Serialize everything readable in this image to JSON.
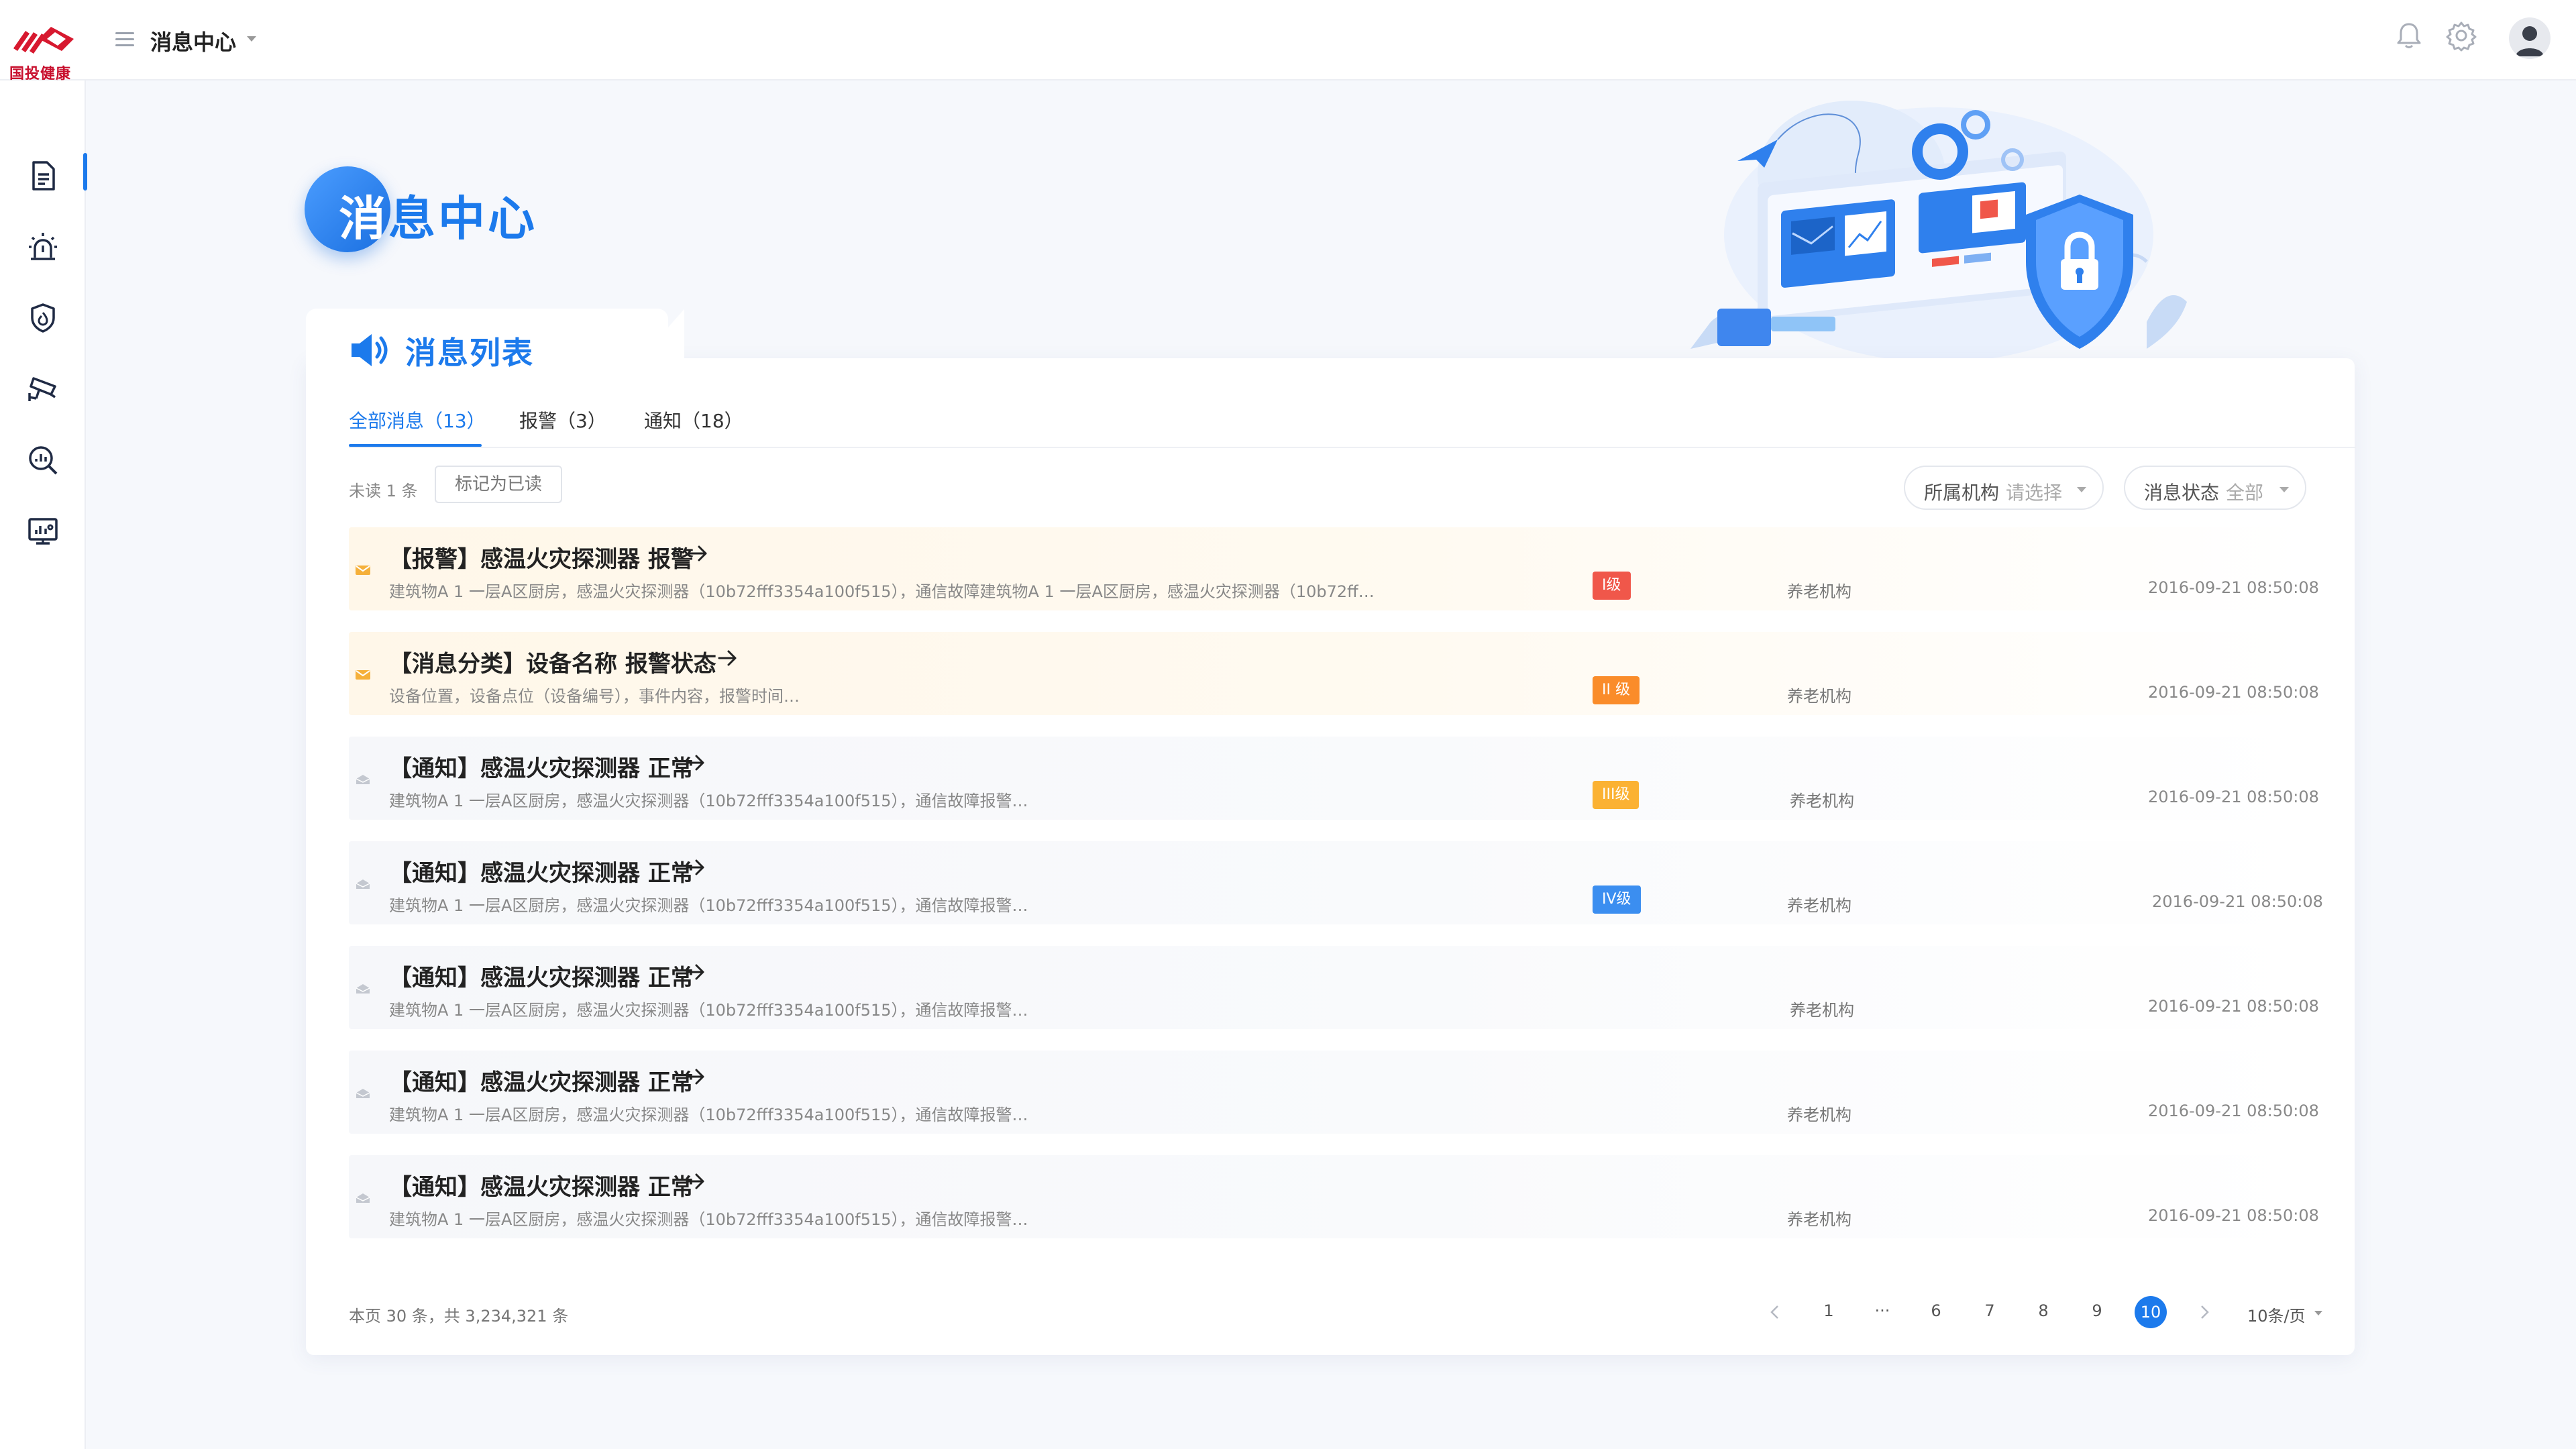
{
  "brand": {
    "logo_text": "国投健康"
  },
  "header": {
    "breadcrumb": "消息中心"
  },
  "page": {
    "title_first": "消",
    "title_rest": "息中心",
    "list_heading": "消息列表"
  },
  "tabs": [
    {
      "label": "全部消息（13）"
    },
    {
      "label": "报警（3）"
    },
    {
      "label": "通知（18）"
    }
  ],
  "toolbar": {
    "unread_text": "未读 1 条",
    "mark_read_label": "标记为已读"
  },
  "filters": {
    "org": {
      "label": "所属机构",
      "placeholder": "请选择"
    },
    "status": {
      "label": "消息状态",
      "value": "全部"
    }
  },
  "messages": [
    {
      "title": "【报警】感温火灾探测器 报警",
      "desc": "建筑物A 1 一层A区厨房，感温火灾探测器（10b72fff3354a100f515），通信故障建筑物A 1 一层A区厨房，感温火灾探测器（10b72ff…",
      "level": "I级",
      "level_color": "#f0574a",
      "org": "养老机构",
      "time": "2016-09-21  08:50:08",
      "unread": true
    },
    {
      "title": "【消息分类】设备名称 报警状态",
      "desc": "设备位置，设备点位（设备编号），事件内容，报警时间…",
      "level": "II 级",
      "level_color": "#fa8c2a",
      "org": "养老机构",
      "time": "2016-09-21  08:50:08",
      "unread": true
    },
    {
      "title": "【通知】感温火灾探测器 正常",
      "desc": "建筑物A 1 一层A区厨房，感温火灾探测器（10b72fff3354a100f515），通信故障报警…",
      "level": "III级",
      "level_color": "#fbb233",
      "org": "养老机构",
      "time": "2016-09-21  08:50:08",
      "unread": false
    },
    {
      "title": "【通知】感温火灾探测器 正常",
      "desc": "建筑物A 1 一层A区厨房，感温火灾探测器（10b72fff3354a100f515），通信故障报警…",
      "level": "IV级",
      "level_color": "#3b8ef0",
      "org": "养老机构",
      "time": "2016-09-21  08:50:08",
      "unread": false
    },
    {
      "title": "【通知】感温火灾探测器 正常",
      "desc": "建筑物A 1 一层A区厨房，感温火灾探测器（10b72fff3354a100f515），通信故障报警…",
      "level": "",
      "level_color": "",
      "org": "养老机构",
      "time": "2016-09-21  08:50:08",
      "unread": false
    },
    {
      "title": "【通知】感温火灾探测器 正常",
      "desc": "建筑物A 1 一层A区厨房，感温火灾探测器（10b72fff3354a100f515），通信故障报警…",
      "level": "",
      "level_color": "",
      "org": "养老机构",
      "time": "2016-09-21  08:50:08",
      "unread": false
    },
    {
      "title": "【通知】感温火灾探测器 正常",
      "desc": "建筑物A 1 一层A区厨房，感温火灾探测器（10b72fff3354a100f515），通信故障报警…",
      "level": "",
      "level_color": "",
      "org": "养老机构",
      "time": "2016-09-21  08:50:08",
      "unread": false
    }
  ],
  "footer": {
    "summary": "本页 30 条，共 3,234,321 条",
    "pages": [
      "1",
      "···",
      "6",
      "7",
      "8",
      "9",
      "10"
    ],
    "current_page": "10",
    "page_size": "10条/页"
  },
  "colors": {
    "accent": "#1c7aec",
    "brand_red": "#c8102e"
  }
}
